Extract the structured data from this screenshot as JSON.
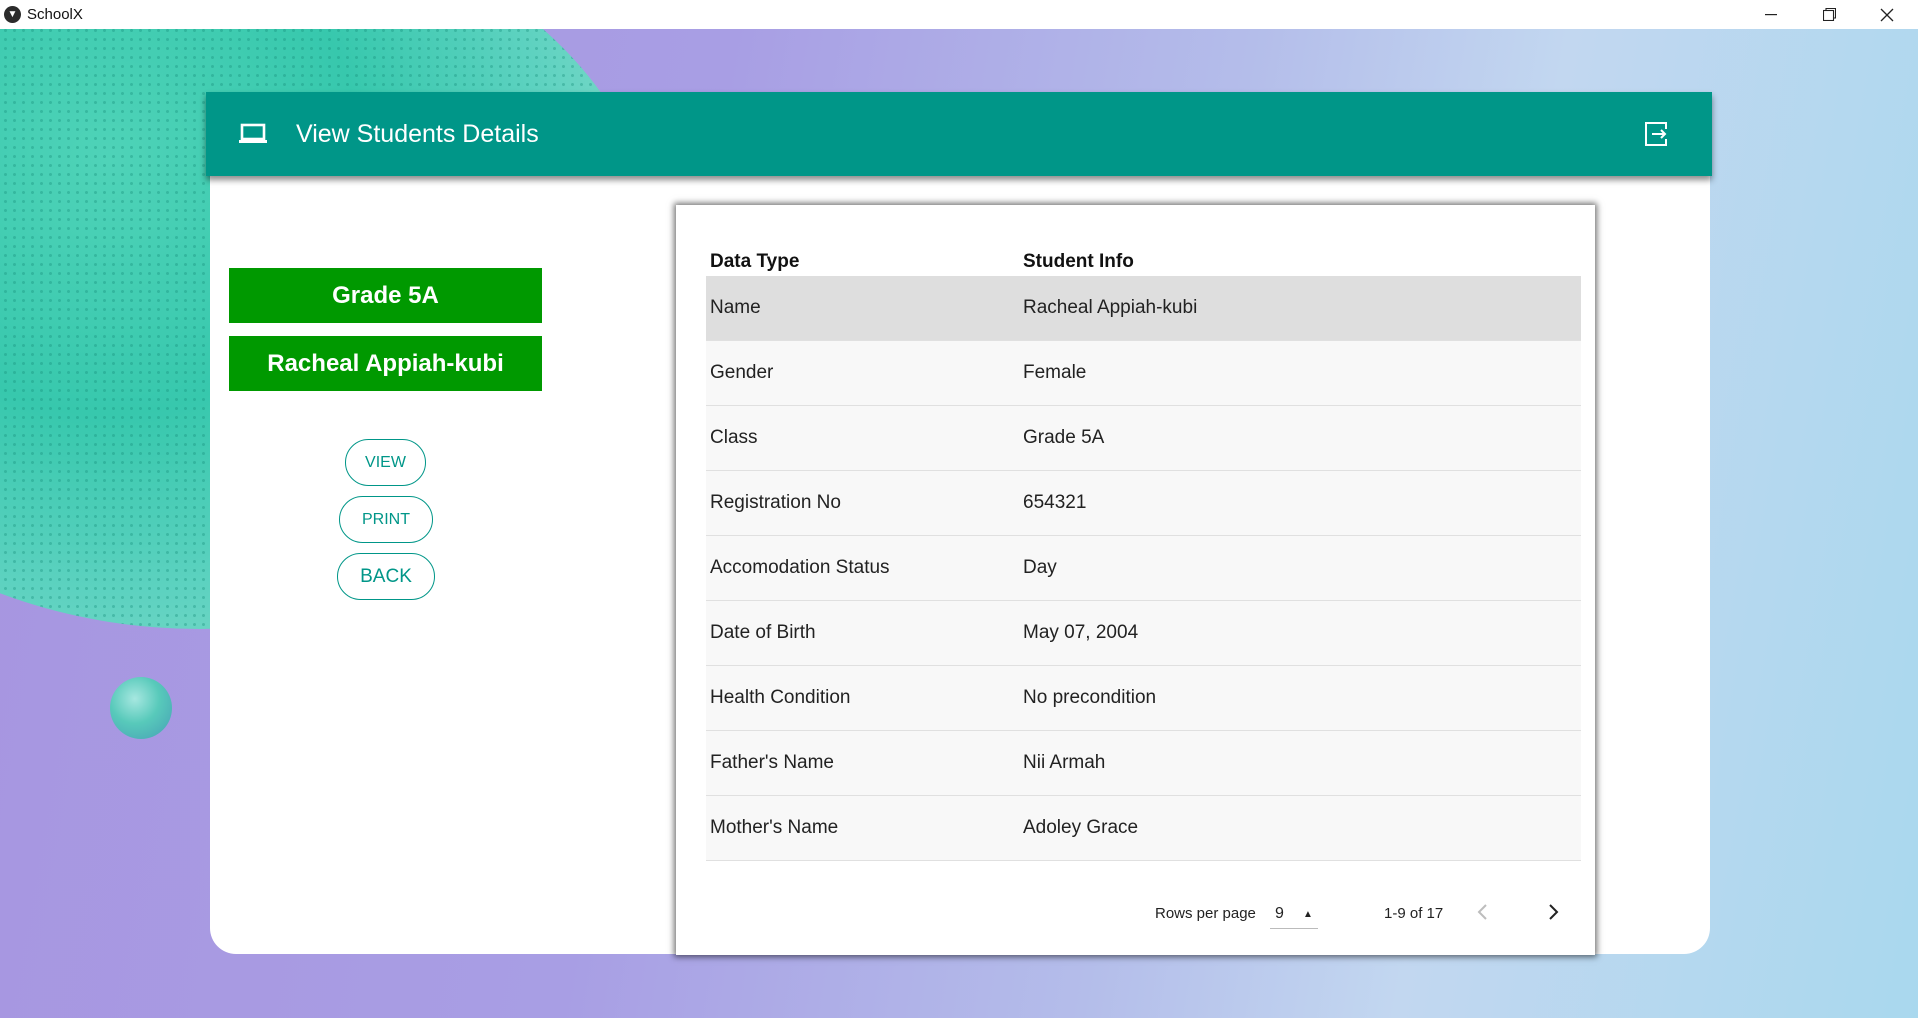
{
  "window": {
    "title": "SchoolX",
    "icons": [
      "app-logo-icon",
      "minimize-icon",
      "restore-icon",
      "close-icon"
    ]
  },
  "header": {
    "title": "View Students Details",
    "icons": [
      "laptop-icon",
      "logout-icon"
    ],
    "color": "#009688"
  },
  "sidebar": {
    "grade": "Grade 5A",
    "student_name": "Racheal Appiah-kubi",
    "chip_color": "#009900",
    "view_label": "VIEW",
    "print_label": "PRINT",
    "back_label": "BACK"
  },
  "table": {
    "columns": [
      "Data Type",
      "Student Info"
    ],
    "rows": [
      {
        "type": "Name",
        "info": "Racheal Appiah-kubi"
      },
      {
        "type": "Gender",
        "info": "Female"
      },
      {
        "type": "Class",
        "info": "Grade 5A"
      },
      {
        "type": "Registration No",
        "info": "654321"
      },
      {
        "type": "Accomodation Status",
        "info": "Day"
      },
      {
        "type": "Date of Birth",
        "info": "May 07, 2004"
      },
      {
        "type": "Health Condition",
        "info": "No precondition"
      },
      {
        "type": "Father's Name",
        "info": "Nii Armah"
      },
      {
        "type": "Mother's Name",
        "info": "Adoley Grace"
      }
    ],
    "selected_row": 0,
    "pagination": {
      "rows_per_page_label": "Rows per page",
      "rows_per_page": "9",
      "range": "1-9 of 17",
      "icons": [
        "chevron-left-icon",
        "chevron-right-icon"
      ]
    }
  }
}
